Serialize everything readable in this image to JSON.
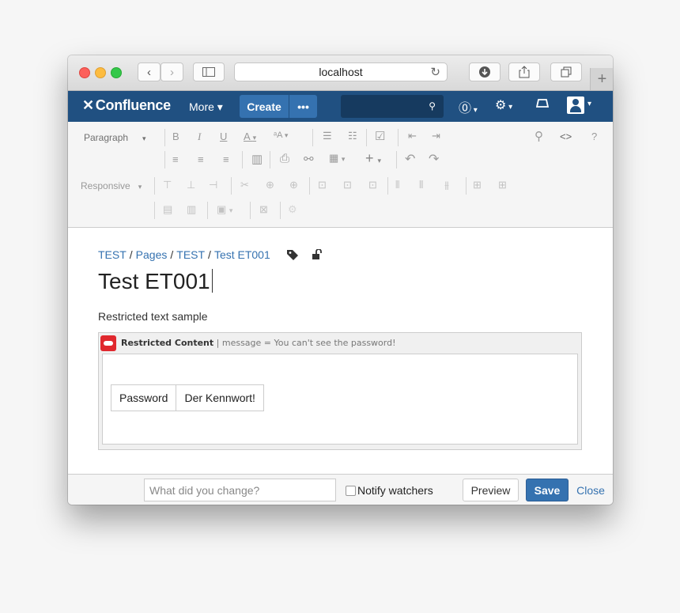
{
  "browser": {
    "address": "localhost",
    "reload_glyph": "↻",
    "back_glyph": "‹",
    "forward_glyph": "›",
    "new_tab_glyph": "+"
  },
  "header": {
    "logo": "Confluence",
    "more": "More ▾",
    "create": "Create",
    "create_more": "•••",
    "search_placeholder": ""
  },
  "toolbar": {
    "paragraph": "Paragraph",
    "responsive": "Responsive"
  },
  "page": {
    "breadcrumbs": [
      "TEST",
      "Pages",
      "TEST",
      "Test ET001"
    ],
    "title": "Test ET001",
    "body_text": "Restricted text sample",
    "macro": {
      "name": "Restricted Content",
      "params": "| message = You can't see the password!"
    },
    "table": [
      [
        "Password",
        "Der Kennwort!"
      ]
    ]
  },
  "footer": {
    "comment_placeholder": "What did you change?",
    "notify": "Notify watchers",
    "preview": "Preview",
    "save": "Save",
    "close": "Close"
  }
}
